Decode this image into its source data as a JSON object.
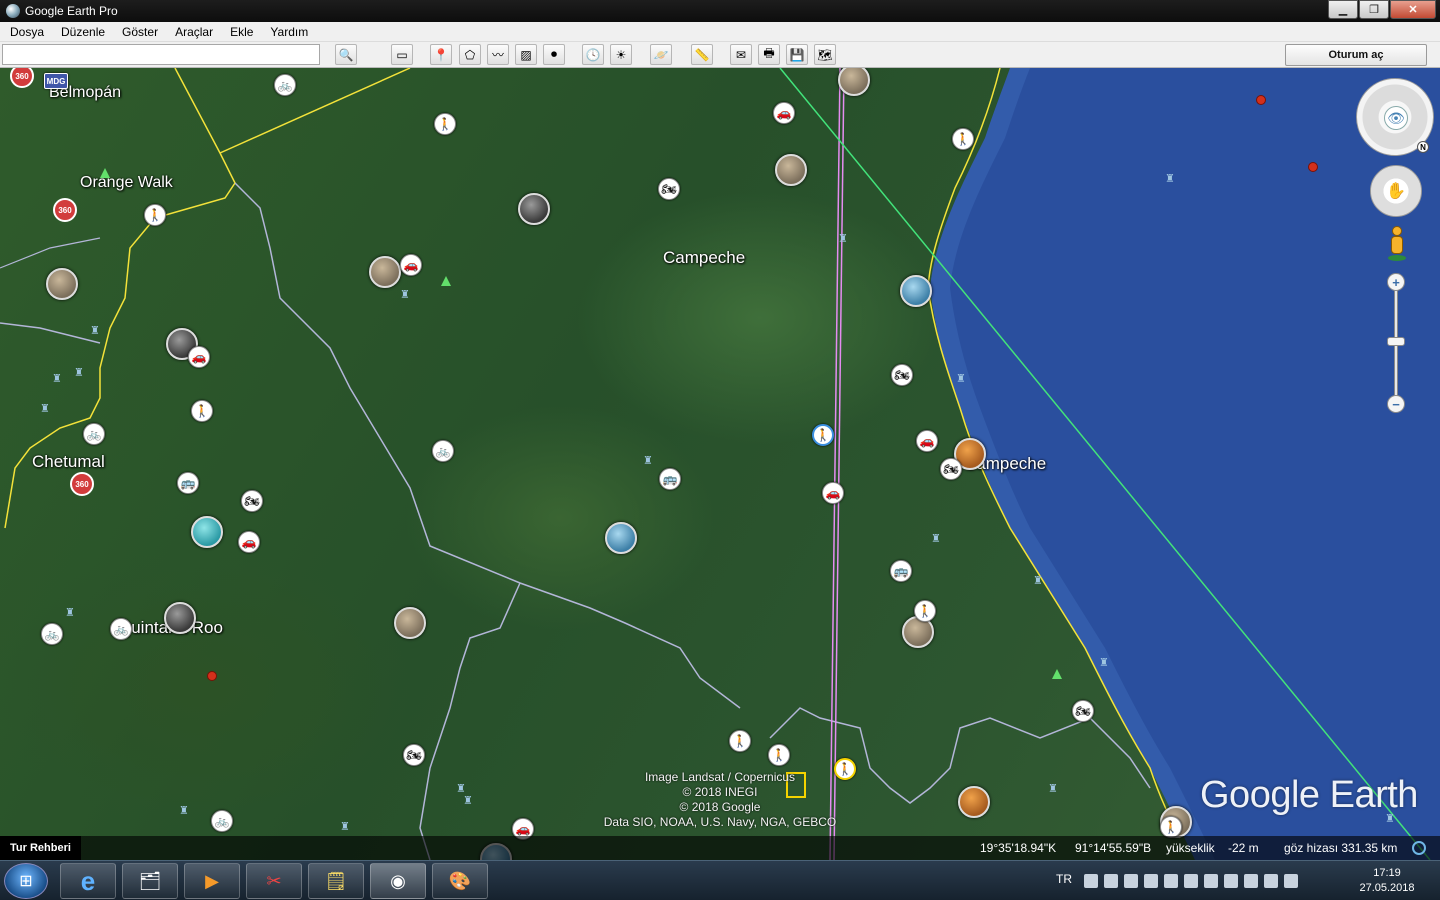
{
  "window": {
    "title": "Google Earth Pro",
    "minimize": "▁",
    "maximize": "❐",
    "close": "✕"
  },
  "menu": [
    "Dosya",
    "Düzenle",
    "Göster",
    "Araçlar",
    "Ekle",
    "Yardım"
  ],
  "toolbar": {
    "search_value": "",
    "signin_label": "Oturum aç",
    "buttons": [
      {
        "name": "search-icon",
        "glyph": "🔍"
      },
      {
        "name": "sidebar-toggle-icon",
        "glyph": "▭"
      },
      {
        "name": "add-placemark-icon",
        "glyph": "📍"
      },
      {
        "name": "add-polygon-icon",
        "glyph": "⬠"
      },
      {
        "name": "add-path-icon",
        "glyph": "〰"
      },
      {
        "name": "add-image-overlay-icon",
        "glyph": "▨"
      },
      {
        "name": "record-tour-icon",
        "glyph": "⏺"
      },
      {
        "name": "historical-imagery-icon",
        "glyph": "🕓"
      },
      {
        "name": "sunlight-icon",
        "glyph": "☀"
      },
      {
        "name": "planets-icon",
        "glyph": "🪐"
      },
      {
        "name": "ruler-icon",
        "glyph": "📏"
      },
      {
        "name": "email-icon",
        "glyph": "✉"
      },
      {
        "name": "print-icon",
        "glyph": "🖶"
      },
      {
        "name": "save-image-icon",
        "glyph": "💾"
      },
      {
        "name": "view-in-maps-icon",
        "glyph": "🗺"
      }
    ]
  },
  "map": {
    "labels": {
      "belmopan": "Belmopán",
      "orange_walk": "Orange Walk",
      "campeche_region": "Campeche",
      "chetumal": "Chetumal",
      "campeche_city": "Campeche",
      "quintana_roo": "Quintana Roo"
    },
    "badge_360": "360",
    "mdg_label": "MDG",
    "attribution": [
      "Image Landsat / Copernicus",
      "© 2018 INEGI",
      "© 2018 Google",
      "Data SIO, NOAA, U.S. Navy, NGA, GEBCO"
    ],
    "logo": "Google Earth",
    "compass_north": "N",
    "zoom_in": "+",
    "zoom_out": "−"
  },
  "status": {
    "tour_guide": "Tur Rehberi",
    "latitude": "19°35'18.94\"K",
    "longitude": "91°14'55.59\"B",
    "elevation_label": "yükseklik",
    "elevation_value": "-22 m",
    "eye_alt": "göz hizası 331.35 km"
  },
  "taskbar": {
    "lang": "TR",
    "time": "17:19",
    "date": "27.05.2018",
    "start_glyph": "⊞",
    "apps": [
      {
        "name": "ie-app-icon",
        "glyph": "e"
      },
      {
        "name": "explorer-app-icon",
        "glyph": "🗂"
      },
      {
        "name": "media-player-app-icon",
        "glyph": "▶"
      },
      {
        "name": "snipping-tool-app-icon",
        "glyph": "✂"
      },
      {
        "name": "notes-app-icon",
        "glyph": "🗒"
      },
      {
        "name": "google-earth-app-icon",
        "glyph": "◉"
      },
      {
        "name": "paint-app-icon",
        "glyph": "🎨"
      }
    ]
  },
  "colors": {
    "ocean": "#2a4f9e",
    "border_yellow": "#f3e23a",
    "border_gray": "#b3b6d8",
    "line_pink": "#e48cf0",
    "line_green": "#42e37a"
  }
}
